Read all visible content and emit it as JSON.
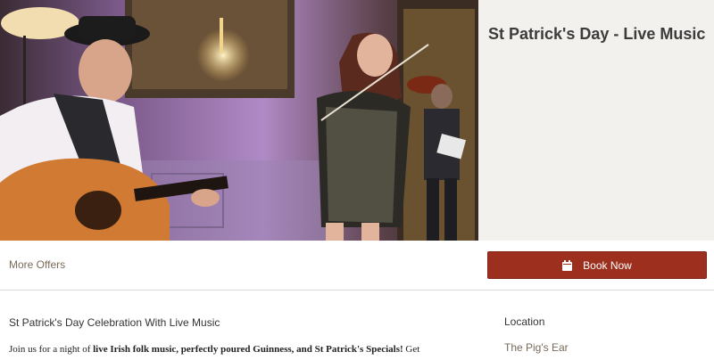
{
  "event": {
    "title": "St Patrick's Day - Live Music"
  },
  "actions": {
    "more_offers_label": "More Offers",
    "book_now_label": "Book Now",
    "book_icon": "calendar-icon"
  },
  "content": {
    "intro_heading": "St Patrick's Day Celebration With Live Music",
    "description_start": "Join us for a night of ",
    "description_bold": "live Irish folk music, perfectly poured Guinness, and St Patrick's Specials!",
    "description_end": " Get"
  },
  "location": {
    "label": "Location",
    "value": "The Pig's Ear"
  },
  "colors": {
    "accent": "#9c2f1e",
    "title_panel_bg": "#f3f1ed",
    "link": "#7a6a5a"
  }
}
